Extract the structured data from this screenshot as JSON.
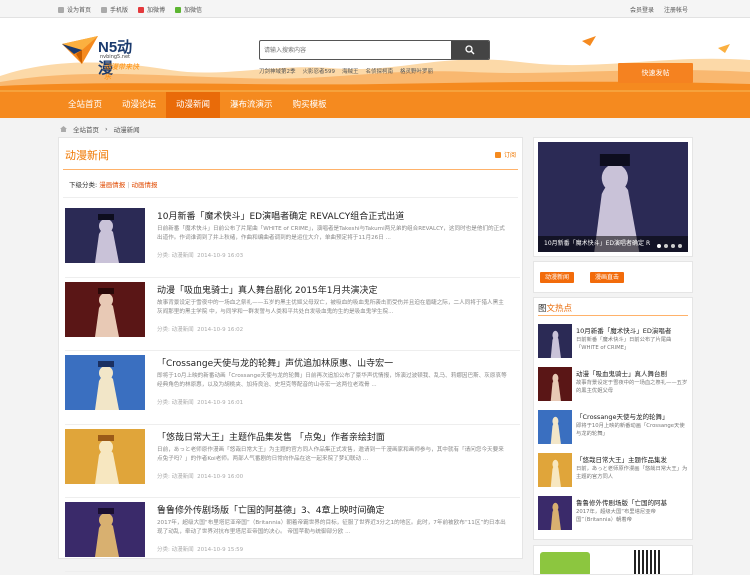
{
  "topbar": {
    "left": [
      {
        "icon": "home-icon",
        "label": "设为首页"
      },
      {
        "icon": "mobile-icon",
        "label": "手机版"
      },
      {
        "icon": "weibo-icon",
        "label": "加微博"
      },
      {
        "icon": "wechat-icon",
        "label": "加微信"
      }
    ],
    "login": "会员登录",
    "register": "注册帐号"
  },
  "header": {
    "brand": "N5动漫",
    "url": "nvbing5.net",
    "slogan": "动漫带来快乐",
    "search_placeholder": "请输入搜索内容",
    "hotwords": [
      "刀剑神域第2季",
      "火影忍者599",
      "海贼王",
      "名侦探柯南",
      "格灵野叶罗丽"
    ],
    "post_button": "快速发帖"
  },
  "nav": {
    "items": [
      "全站首页",
      "动漫论坛",
      "动漫新闻",
      "瀑布流演示",
      "购买模板"
    ],
    "active": 2
  },
  "breadcrumb": [
    "全站首页",
    "动漫新闻"
  ],
  "main": {
    "heading": "动漫新闻",
    "rss": "订阅",
    "subcat_label": "下级分类:",
    "subcats": [
      "漫画情报",
      "动画情报"
    ],
    "articles": [
      {
        "title": "10月新番「魔术快斗」ED演唱者确定 REVALCY组合正式出道",
        "desc": "日前新番「魔术快斗」日前公布了片尾曲「WHITE of CRIME」，演唱者是Takeshi与Takumi两兄弟的组合REVALCY，这同时也是他们的正式出道作。作词谁调到了井上秋绪，作曲和编曲者调到的是运位大介，单曲预定将于11月26日 ...",
        "category": "分类: 动漫新闻",
        "date": "2014-10-9 16:03",
        "colors": [
          "#2b2a55",
          "#c9c2d8",
          "#0d0d1e"
        ]
      },
      {
        "title": "动漫「吸血鬼骑士」真人舞台剧化 2015年1月共演决定",
        "desc": "故事背景设定于雪夜中的一场血之祭礼——五岁的黑主优姬父母双亡，被吸血的吸血鬼所袭击而受伤并且迫在眉睫之际，二人同将于猎人黑主灰阎那里的黑主学院 中，与同学和一群发誓与人类和平共处白发吸血鬼的生的是吸血鬼学生院...",
        "category": "分类: 动漫新闻",
        "date": "2014-10-9 16:02",
        "colors": [
          "#5a1616",
          "#e8c9b5",
          "#2a0808"
        ]
      },
      {
        "title": "「Crossange天使与龙的轮舞」声优追加林原惠、山寺宏一",
        "desc": "即将于10月上映的新番动画「Crossange天使与龙的轮舞」日前再次追加公布了豪华声优情报，饰演过波顿我、乱马、莉娜因巴斯、灰原哀等经典角色的林原惠，以及为胡桃夹、加持良治、史坦克等配音的山寺宏一这两位老戏骨 ...",
        "category": "分类: 动漫新闻",
        "date": "2014-10-9 16:01",
        "colors": [
          "#3a6fc0",
          "#f2e6c8",
          "#1a2f60"
        ]
      },
      {
        "title": "「悠哉日常大王」主题作品集发售 「点兔」作者亲绘封面",
        "desc": "日前，あっと老师原作漫画「悠哉日常大王」为主题的官方同人作品集正式发售，邀请到一千漫画家和画师参与，其中就有「请问您今天要来点兔子吗？」的作者Koi老师。两部人气番剧的日常向作品在这一起来院了梦幻联动 ...",
        "category": "分类: 动漫新闻",
        "date": "2014-10-9 16:00",
        "colors": [
          "#e0a53a",
          "#f7e7c0",
          "#9a5a18"
        ]
      },
      {
        "title": "鲁鲁修外传剧场版「亡国的阿基德」3、4章上映时间确定",
        "desc": "2017年，超级大国“布里塔尼亚帝国”（Britannia）朝着帝霸世界的目标，征服了世界近3分之1的地区。此时，7年前被欧布“11区”的日本出现了动乱，牵动了世界对抗布里塔尼亚帝国的决心。 帝国苹勒与统御部分欧 ...",
        "category": "分类: 动漫新闻",
        "date": "2014-10-9 15:59",
        "colors": [
          "#3a2a6a",
          "#d8b070",
          "#1a0f30"
        ]
      }
    ]
  },
  "sidebar": {
    "slider_caption": "10月新番「魔术快斗」ED演唱者确定 R",
    "slider_dots": 4,
    "tags": [
      "动漫新闻",
      "漫画直击"
    ],
    "hot_prefix": "图",
    "hot_title": "文热点",
    "hot_items": [
      {
        "title": "10月新番「魔术快斗」ED演唱者",
        "desc": "日前新番「魔术快斗」日前公布了片尾曲「WHITE of CRIME」",
        "colors": [
          "#2b2a55",
          "#c9c2d8"
        ]
      },
      {
        "title": "动漫「吸血鬼骑士」真人舞台剧",
        "desc": "故事背景设定于雪夜中的一场血之祭礼——五岁的黑主优姬父母",
        "colors": [
          "#5a1616",
          "#e8c9b5"
        ]
      },
      {
        "title": "「Crossange天使与龙的轮舞」",
        "desc": "即将于10月上映的新番动画「Crossange天使与龙的轮舞」",
        "colors": [
          "#3a6fc0",
          "#f2e6c8"
        ]
      },
      {
        "title": "「悠哉日常大王」主题作品集发",
        "desc": "日前，あっと老师原作漫画「悠哉日常大王」为主题的官方同人",
        "colors": [
          "#e0a53a",
          "#f7e7c0"
        ]
      },
      {
        "title": "鲁鲁修外传剧场版「亡国的阿基",
        "desc": "2017年，超级大国“布里塔尼亚帝国”（Britannia）朝着帝",
        "colors": [
          "#3a2a6a",
          "#d8b070"
        ]
      }
    ]
  },
  "theme": {
    "accent": "#f58a1f",
    "accent_dark": "#e96b09",
    "link_red": "#e04a00"
  }
}
